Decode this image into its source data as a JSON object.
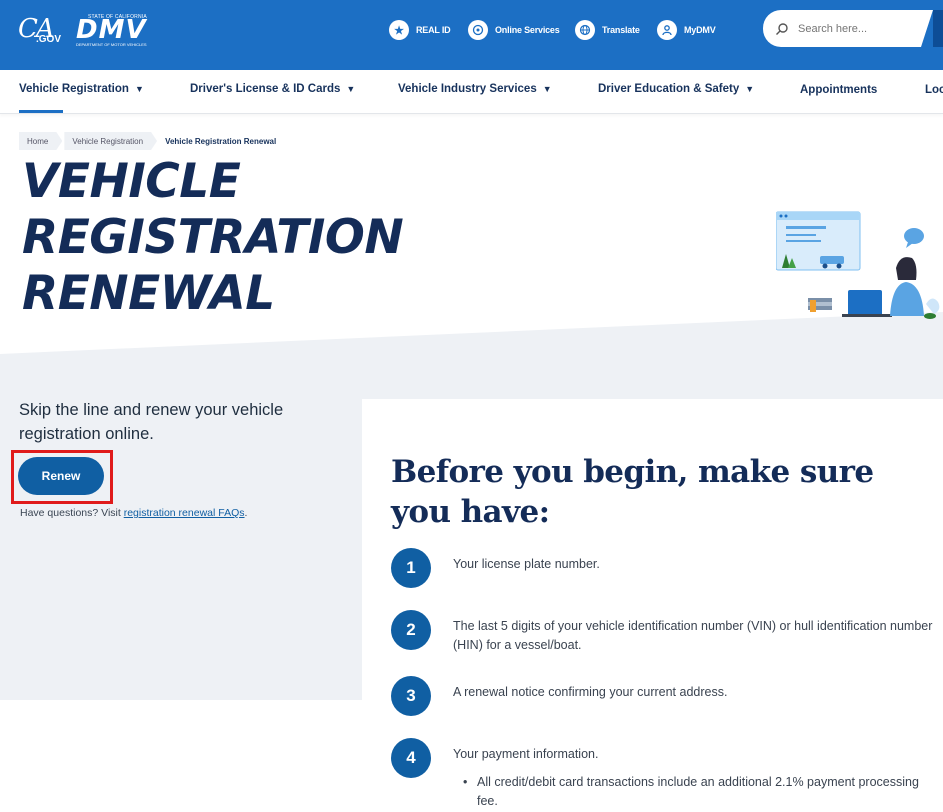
{
  "header": {
    "ca_logo_main": "CA",
    "ca_logo_sub": ".GOV",
    "dmv_state": "STATE OF CALIFORNIA",
    "dmv_mark": "DMV",
    "dmv_dept": "DEPARTMENT OF MOTOR VEHICLES",
    "utilities": [
      {
        "label": "REAL ID",
        "icon": "star-icon"
      },
      {
        "label": "Online Services",
        "icon": "globe-grid-icon"
      },
      {
        "label": "Translate",
        "icon": "translate-globe-icon"
      },
      {
        "label": "MyDMV",
        "icon": "user-icon"
      }
    ],
    "search_placeholder": "Search here..."
  },
  "nav": {
    "items": [
      {
        "label": "Vehicle Registration",
        "dropdown": true
      },
      {
        "label": "Driver's License & ID Cards",
        "dropdown": true
      },
      {
        "label": "Vehicle Industry Services",
        "dropdown": true
      },
      {
        "label": "Driver Education & Safety",
        "dropdown": true
      },
      {
        "label": "Appointments",
        "dropdown": false
      },
      {
        "label": "Loc",
        "dropdown": false
      }
    ]
  },
  "breadcrumb": [
    "Home",
    "Vehicle Registration",
    "Vehicle Registration Renewal"
  ],
  "hero": {
    "title_lines": [
      "Vehicle",
      "Registration",
      "Renewal"
    ]
  },
  "left": {
    "intro": "Skip the line and renew your vehicle registration online.",
    "renew_label": "Renew",
    "faq_prefix": "Have questions? Visit ",
    "faq_link": "registration renewal FAQs",
    "faq_suffix": "."
  },
  "card": {
    "title": "Before you begin, make sure you have:",
    "steps": [
      {
        "num": "1",
        "text": "Your license plate number."
      },
      {
        "num": "2",
        "text": "The last 5 digits of your vehicle identification number (VIN) or hull identification number (HIN) for a vessel/boat."
      },
      {
        "num": "3",
        "text": "A renewal notice confirming your current address."
      },
      {
        "num": "4",
        "text": "Your payment information."
      }
    ],
    "bullet": "All credit/debit card transactions include an additional 2.1% payment processing fee."
  },
  "colors": {
    "header_blue": "#1c6fc4",
    "navy": "#142c58",
    "button_blue": "#105fa3",
    "highlight_red": "#e01b1b",
    "band_grey": "#eef1f5"
  }
}
